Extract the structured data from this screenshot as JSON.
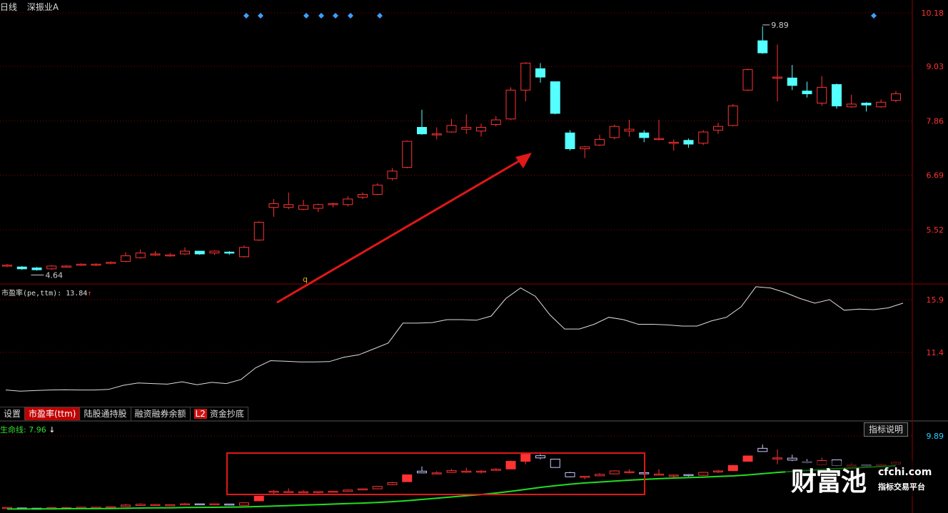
{
  "header": {
    "period": "日线",
    "stock": "深振业A"
  },
  "main_axis": {
    "ticks": [
      "10.18",
      "9.03",
      "7.86",
      "6.69",
      "5.52"
    ]
  },
  "annotations": {
    "low": "4.64",
    "high": "9.89",
    "marker": "q"
  },
  "pe_panel": {
    "label": "市盈率(pe,ttm): 13.84",
    "ticks": [
      "15.9",
      "11.4"
    ],
    "values": [
      8.2,
      8.1,
      8.15,
      8.2,
      8.22,
      8.2,
      8.2,
      8.25,
      8.6,
      8.8,
      8.75,
      8.7,
      8.9,
      8.65,
      8.85,
      8.75,
      9.1,
      10.1,
      10.7,
      10.65,
      10.6,
      10.6,
      10.62,
      11.0,
      11.2,
      11.7,
      12.2,
      13.9,
      13.9,
      13.95,
      14.2,
      14.2,
      14.15,
      14.5,
      16.0,
      16.9,
      16.2,
      14.6,
      13.4,
      13.4,
      13.8,
      14.4,
      14.2,
      13.8,
      13.8,
      13.75,
      13.65,
      13.65,
      14.1,
      14.4,
      15.3,
      17.0,
      16.9,
      16.5,
      16.0,
      15.6,
      15.9,
      15.0,
      15.1,
      15.05,
      15.2,
      15.6
    ]
  },
  "tabs": [
    {
      "label": "设置",
      "active": false
    },
    {
      "label": "市盈率(ttm)",
      "active": true
    },
    {
      "label": "陆股通持股",
      "active": false
    },
    {
      "label": "融资融券余额",
      "active": false
    },
    {
      "label": "资金抄底",
      "active": false,
      "badge": "L2"
    }
  ],
  "bottom_panel": {
    "label": "生命线: 7.96",
    "button": "指标说明",
    "ticks": [
      "9.89"
    ]
  },
  "candles": [
    [
      4.74,
      4.76,
      4.72,
      4.78
    ],
    [
      4.72,
      4.68,
      4.66,
      4.74
    ],
    [
      4.7,
      4.66,
      4.64,
      4.72
    ],
    [
      4.68,
      4.74,
      4.66,
      4.76
    ],
    [
      4.74,
      4.74,
      4.72,
      4.76
    ],
    [
      4.76,
      4.78,
      4.74,
      4.8
    ],
    [
      4.78,
      4.78,
      4.74,
      4.8
    ],
    [
      4.8,
      4.82,
      4.78,
      4.84
    ],
    [
      4.84,
      4.96,
      4.82,
      5.04
    ],
    [
      4.92,
      5.02,
      4.9,
      5.1
    ],
    [
      4.98,
      5.0,
      4.96,
      5.06
    ],
    [
      4.98,
      4.98,
      4.94,
      5.02
    ],
    [
      5.0,
      5.06,
      4.98,
      5.14
    ],
    [
      5.06,
      5.0,
      4.98,
      5.06
    ],
    [
      5.02,
      5.06,
      4.98,
      5.08
    ],
    [
      5.04,
      5.02,
      4.98,
      5.06
    ],
    [
      4.94,
      5.14,
      4.92,
      5.18
    ],
    [
      5.3,
      5.68,
      5.28,
      5.7
    ],
    [
      6.0,
      6.08,
      5.8,
      6.18
    ],
    [
      6.0,
      6.06,
      5.96,
      6.32
    ],
    [
      5.96,
      6.04,
      5.94,
      6.16
    ],
    [
      5.98,
      6.06,
      5.9,
      6.08
    ],
    [
      6.06,
      6.08,
      6.0,
      6.1
    ],
    [
      6.06,
      6.18,
      6.02,
      6.24
    ],
    [
      6.22,
      6.28,
      6.18,
      6.32
    ],
    [
      6.28,
      6.48,
      6.26,
      6.52
    ],
    [
      6.62,
      6.78,
      6.58,
      6.84
    ],
    [
      6.86,
      7.42,
      6.84,
      7.44
    ],
    [
      7.72,
      7.58,
      7.56,
      8.1
    ],
    [
      7.56,
      7.58,
      7.46,
      7.72
    ],
    [
      7.62,
      7.76,
      7.6,
      7.9
    ],
    [
      7.68,
      7.72,
      7.58,
      8.0
    ],
    [
      7.64,
      7.72,
      7.52,
      7.8
    ],
    [
      7.78,
      7.88,
      7.74,
      7.96
    ],
    [
      7.9,
      8.52,
      7.88,
      8.58
    ],
    [
      8.52,
      9.1,
      8.28,
      9.12
    ],
    [
      8.98,
      8.8,
      8.68,
      9.1
    ],
    [
      8.7,
      8.02,
      8.0,
      8.7
    ],
    [
      7.6,
      7.26,
      7.22,
      7.66
    ],
    [
      7.26,
      7.3,
      7.06,
      7.32
    ],
    [
      7.34,
      7.46,
      7.32,
      7.56
    ],
    [
      7.5,
      7.74,
      7.46,
      7.78
    ],
    [
      7.64,
      7.68,
      7.52,
      7.88
    ],
    [
      7.6,
      7.5,
      7.4,
      7.66
    ],
    [
      7.48,
      7.48,
      7.44,
      7.88
    ],
    [
      7.38,
      7.4,
      7.22,
      7.46
    ],
    [
      7.44,
      7.36,
      7.28,
      7.48
    ],
    [
      7.38,
      7.62,
      7.34,
      7.66
    ],
    [
      7.66,
      7.74,
      7.58,
      7.82
    ],
    [
      7.76,
      8.18,
      7.74,
      8.22
    ],
    [
      8.52,
      8.96,
      8.5,
      8.98
    ],
    [
      9.58,
      9.32,
      9.3,
      9.89
    ],
    [
      8.8,
      8.8,
      8.28,
      9.5
    ],
    [
      8.78,
      8.62,
      8.52,
      9.06
    ],
    [
      8.5,
      8.44,
      8.36,
      8.7
    ],
    [
      8.24,
      8.58,
      8.18,
      8.82
    ],
    [
      8.64,
      8.18,
      8.12,
      8.66
    ],
    [
      8.16,
      8.22,
      8.14,
      8.42
    ],
    [
      8.24,
      8.2,
      8.06,
      8.26
    ],
    [
      8.16,
      8.26,
      8.14,
      8.32
    ],
    [
      8.3,
      8.44,
      8.26,
      8.5
    ]
  ],
  "life_line": [
    4.32,
    4.32,
    4.33,
    4.33,
    4.34,
    4.35,
    4.35,
    4.36,
    4.38,
    4.4,
    4.41,
    4.42,
    4.44,
    4.45,
    4.46,
    4.47,
    4.49,
    4.52,
    4.56,
    4.6,
    4.64,
    4.68,
    4.72,
    4.76,
    4.8,
    4.85,
    4.92,
    5.0,
    5.1,
    5.2,
    5.3,
    5.4,
    5.5,
    5.62,
    5.76,
    5.92,
    6.08,
    6.22,
    6.34,
    6.44,
    6.52,
    6.6,
    6.67,
    6.73,
    6.79,
    6.84,
    6.88,
    6.92,
    6.97,
    7.02,
    7.1,
    7.2,
    7.3,
    7.38,
    7.46,
    7.54,
    7.6,
    7.66,
    7.72,
    7.78,
    7.84
  ],
  "colors": {
    "up": "#ff3232",
    "down": "#54ffff",
    "grid": "#8b0000",
    "arrow": "#e01818",
    "life": "#22dd22",
    "pe": "#dddddd",
    "axis_text": "#ff3232"
  }
}
